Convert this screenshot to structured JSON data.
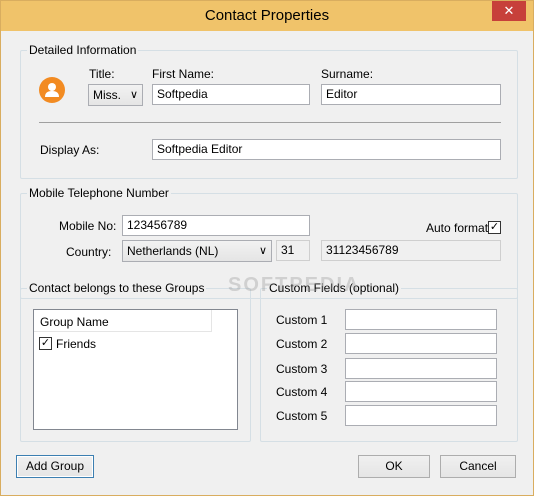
{
  "window": {
    "title": "Contact Properties",
    "close_glyph": "✕"
  },
  "detailed": {
    "legend": "Detailed Information",
    "title_label": "Title:",
    "title_value": "Miss.",
    "first_name_label": "First Name:",
    "first_name_value": "Softpedia",
    "surname_label": "Surname:",
    "surname_value": "Editor",
    "display_as_label": "Display As:",
    "display_as_value": "Softpedia Editor"
  },
  "mobile": {
    "legend": "Mobile Telephone Number",
    "mobile_no_label": "Mobile No:",
    "mobile_no_value": "123456789",
    "auto_format_label": "Auto format",
    "auto_format_checked": true,
    "country_label": "Country:",
    "country_value": "Netherlands (NL)",
    "country_code": "31",
    "formatted_number": "31123456789"
  },
  "groups": {
    "legend": "Contact belongs to these Groups",
    "column_header": "Group Name",
    "items": [
      {
        "label": "Friends",
        "checked": true
      }
    ]
  },
  "custom_fields": {
    "legend": "Custom Fields (optional)",
    "labels": [
      "Custom 1",
      "Custom 2",
      "Custom 3",
      "Custom 4",
      "Custom 5"
    ]
  },
  "buttons": {
    "add_group": "Add Group",
    "ok": "OK",
    "cancel": "Cancel"
  },
  "watermark": "SOFTPEDIA",
  "colors": {
    "title_bar": "#f0c36a",
    "close_button": "#c7403a",
    "avatar": "#f28b22"
  }
}
